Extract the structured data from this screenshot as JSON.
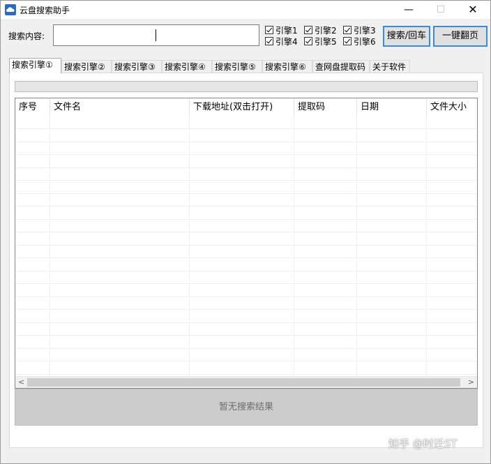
{
  "window": {
    "title": "云盘搜索助手",
    "min_glyph": "—",
    "max_glyph": "☐",
    "close_glyph": "✕"
  },
  "search": {
    "label": "搜索内容:",
    "value": "",
    "search_button": "搜索/回车",
    "flip_button": "一键翻页"
  },
  "engines": [
    {
      "label": "引擎1",
      "checked": true
    },
    {
      "label": "引擎2",
      "checked": true
    },
    {
      "label": "引擎3",
      "checked": true
    },
    {
      "label": "引擎4",
      "checked": true
    },
    {
      "label": "引擎5",
      "checked": true
    },
    {
      "label": "引擎6",
      "checked": true
    }
  ],
  "tabs": [
    {
      "label": "搜索引擎①",
      "active": true
    },
    {
      "label": "搜索引擎②",
      "active": false
    },
    {
      "label": "搜索引擎③",
      "active": false
    },
    {
      "label": "搜索引擎④",
      "active": false
    },
    {
      "label": "搜索引擎⑤",
      "active": false
    },
    {
      "label": "搜索引擎⑥",
      "active": false
    },
    {
      "label": "查网盘提取码",
      "active": false
    },
    {
      "label": "关于软件",
      "active": false
    }
  ],
  "table": {
    "columns": [
      "序号",
      "文件名",
      "下载地址(双击打开)",
      "提取码",
      "日期",
      "文件大小"
    ],
    "rows": []
  },
  "scroll": {
    "left_arrow": "<",
    "right_arrow": ">"
  },
  "status": {
    "result_text": "暂无搜索结果"
  },
  "watermark": "知乎 @时迁ST"
}
